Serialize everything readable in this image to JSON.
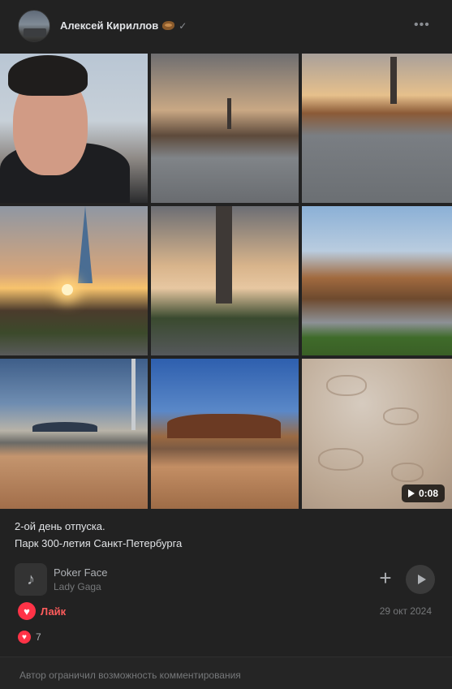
{
  "header": {
    "author_name": "Алексей Кириллов",
    "author_emoji": "hedgehog-emoji-icon",
    "verified_icon": "check-icon",
    "more_icon": "more-horizontal-icon"
  },
  "media": {
    "photo_count": 9,
    "video_duration": "0:08"
  },
  "post": {
    "line1": "2-ой день отпуска.",
    "line2": "Парк 300-летия Санкт-Петербурга"
  },
  "audio": {
    "title": "Poker Face",
    "artist": "Lady Gaga",
    "note_icon": "music-note-icon",
    "add_icon": "plus-icon",
    "play_icon": "play-icon"
  },
  "actions": {
    "like_label": "Лайк",
    "date": "29 окт 2024",
    "reactions_count": "7"
  },
  "footer": {
    "comments_disabled": "Автор ограничил возможность комментирования"
  },
  "colors": {
    "background": "#222222",
    "like_red": "#ff3347",
    "text_primary": "#e1e3e6",
    "text_secondary": "#76787a"
  }
}
